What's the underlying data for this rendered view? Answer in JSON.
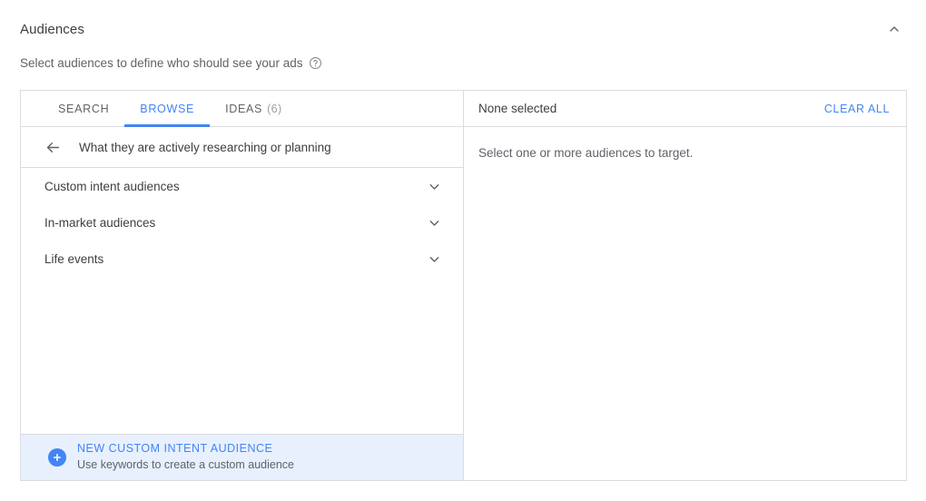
{
  "section": {
    "title": "Audiences",
    "subtitle": "Select audiences to define who should see your ads",
    "help_icon": "help-circle-icon",
    "collapse_icon": "chevron-up-icon"
  },
  "tabs": [
    {
      "label": "SEARCH",
      "count": "",
      "active": false
    },
    {
      "label": "BROWSE",
      "count": "",
      "active": true
    },
    {
      "label": "IDEAS",
      "count": "(6)",
      "active": false
    }
  ],
  "breadcrumb": {
    "back_icon": "arrow-left-icon",
    "label": "What they are actively researching or planning"
  },
  "categories": [
    {
      "label": "Custom intent audiences",
      "chevron": "chevron-down-icon"
    },
    {
      "label": "In-market audiences",
      "chevron": "chevron-down-icon"
    },
    {
      "label": "Life events",
      "chevron": "chevron-down-icon"
    }
  ],
  "cta": {
    "icon": "plus-circle-icon",
    "title": "NEW CUSTOM INTENT AUDIENCE",
    "subtitle": "Use keywords to create a custom audience"
  },
  "selection": {
    "status": "None selected",
    "clear_all_label": "CLEAR ALL",
    "empty_message": "Select one or more audiences to target."
  },
  "colors": {
    "accent_blue": "#4285f4",
    "cta_background": "#e8f0fe",
    "border": "#dadce0",
    "text_primary": "#3c4043",
    "text_secondary": "#5f6368"
  }
}
